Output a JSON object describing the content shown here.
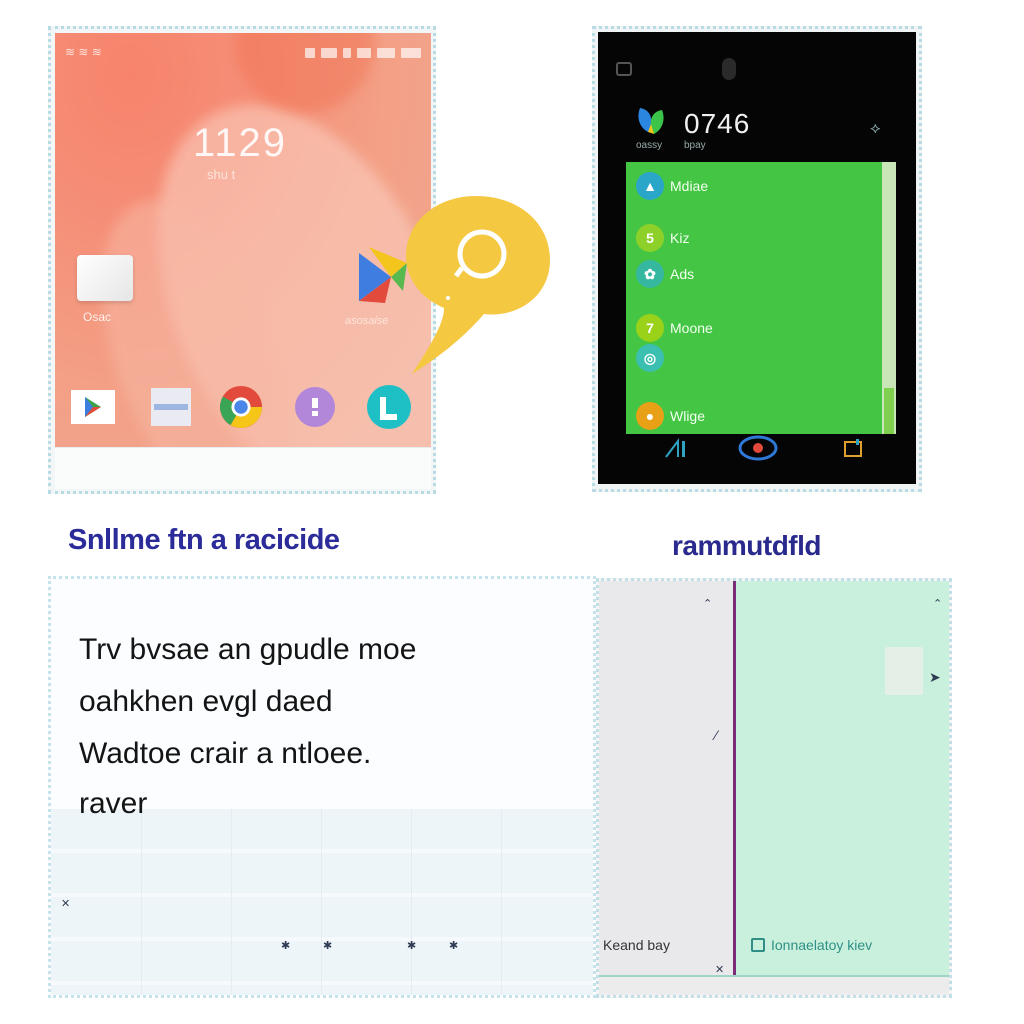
{
  "panel_home": {
    "clock": "1129",
    "date": "shu t",
    "cube_label": "Osac",
    "overlay_text": "asosaise",
    "dock_icons": [
      "play-store-icon",
      "window-icon",
      "chrome-icon",
      "purple-app-icon",
      "teal-app-icon"
    ]
  },
  "panel_dark": {
    "time": "0746",
    "sub_left": "oassy",
    "sub_right": "bpay",
    "apps": [
      {
        "label": "Mdiae",
        "color": "#2aa6c9",
        "glyph": "▲"
      },
      {
        "label": "Kiz",
        "color": "#8ed02a",
        "glyph": "5"
      },
      {
        "label": "Ads",
        "color": "#36b8a0",
        "glyph": "✿"
      },
      {
        "label": "Moone",
        "color": "#9ad21a",
        "glyph": "7"
      },
      {
        "label": "",
        "color": "#3bbfb0",
        "glyph": "◎"
      },
      {
        "label": "Wlige",
        "color": "#e8a016",
        "glyph": "●"
      }
    ]
  },
  "captions": {
    "left": "Snllme ftn a racicide",
    "right": "rammutdfld"
  },
  "panel_text": {
    "lines": [
      "Trv bvsae an gpudle moe",
      "oahkhen evgl daed",
      "Wadtoe crair a ntloee.",
      "raver"
    ]
  },
  "panel_split": {
    "left_label": "Keand bay",
    "right_label": "Ionnaelatoy kiev"
  }
}
